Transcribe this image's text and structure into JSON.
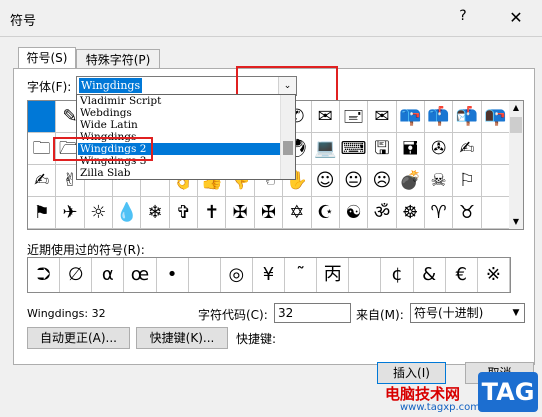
{
  "window": {
    "title": "符号",
    "help_glyph": "?",
    "close_glyph": "✕"
  },
  "tabs": [
    {
      "label": "符号(S)"
    },
    {
      "label": "特殊字符(P)"
    }
  ],
  "font": {
    "label": "字体(F):",
    "value": "Wingdings",
    "arrow_glyph": "⌄"
  },
  "font_dropdown": {
    "items": [
      "Vladimir Script",
      "Webdings",
      "Wide Latin",
      "Wingdings",
      "Wingdings 2",
      "Wingdings 3",
      "Zilla Slab"
    ],
    "selected": "Wingdings 2"
  },
  "symbol_grid": {
    "rows": [
      [
        "",
        "✎",
        "",
        "",
        "",
        "",
        "",
        "",
        "",
        "✆",
        "✉",
        "🖃",
        "✉",
        "📪",
        "📫",
        "📬",
        "📭"
      ],
      [
        "🗀",
        "🗁",
        "",
        "",
        "",
        "",
        "",
        "",
        "",
        "🖲",
        "💻",
        "⌨",
        "🖫",
        "🖬",
        "✇",
        "✍",
        ""
      ],
      [
        "✍",
        "✌",
        "",
        "",
        "",
        "👌",
        "👍",
        "👎",
        "☜",
        "✋",
        "☺",
        "😐",
        "☹",
        "💣",
        "☠",
        "⚐",
        ""
      ],
      [
        "⚑",
        "✈",
        "☼",
        "💧",
        "❄",
        "✞",
        "✝",
        "✠",
        "✠",
        "✡",
        "☪",
        "☯",
        "ॐ",
        "☸",
        "♈",
        "♉",
        ""
      ]
    ]
  },
  "recent": {
    "label": "近期使用过的符号(R):",
    "symbols": [
      "⮊",
      "∅",
      "α",
      "œ",
      "•",
      "",
      "◎",
      "¥",
      "˜",
      "丙",
      "",
      "¢",
      "&",
      "€",
      "※"
    ]
  },
  "charinfo": {
    "name": "Wingdings: 32",
    "code_label": "字符代码(C):",
    "code_value": "32",
    "from_label": "来自(M):",
    "from_value": "符号(十进制)",
    "shortcut_label": "快捷键:"
  },
  "buttons": {
    "autocorrect": "自动更正(A)...",
    "shortcut_key": "快捷键(K)...",
    "insert": "插入(I)",
    "cancel": "取消"
  },
  "watermark": {
    "text": "电脑技术网",
    "site": "www.tagxp.com",
    "logo": "TAG"
  },
  "colors": {
    "accent": "#0078d7",
    "highlight": "#e02020"
  }
}
